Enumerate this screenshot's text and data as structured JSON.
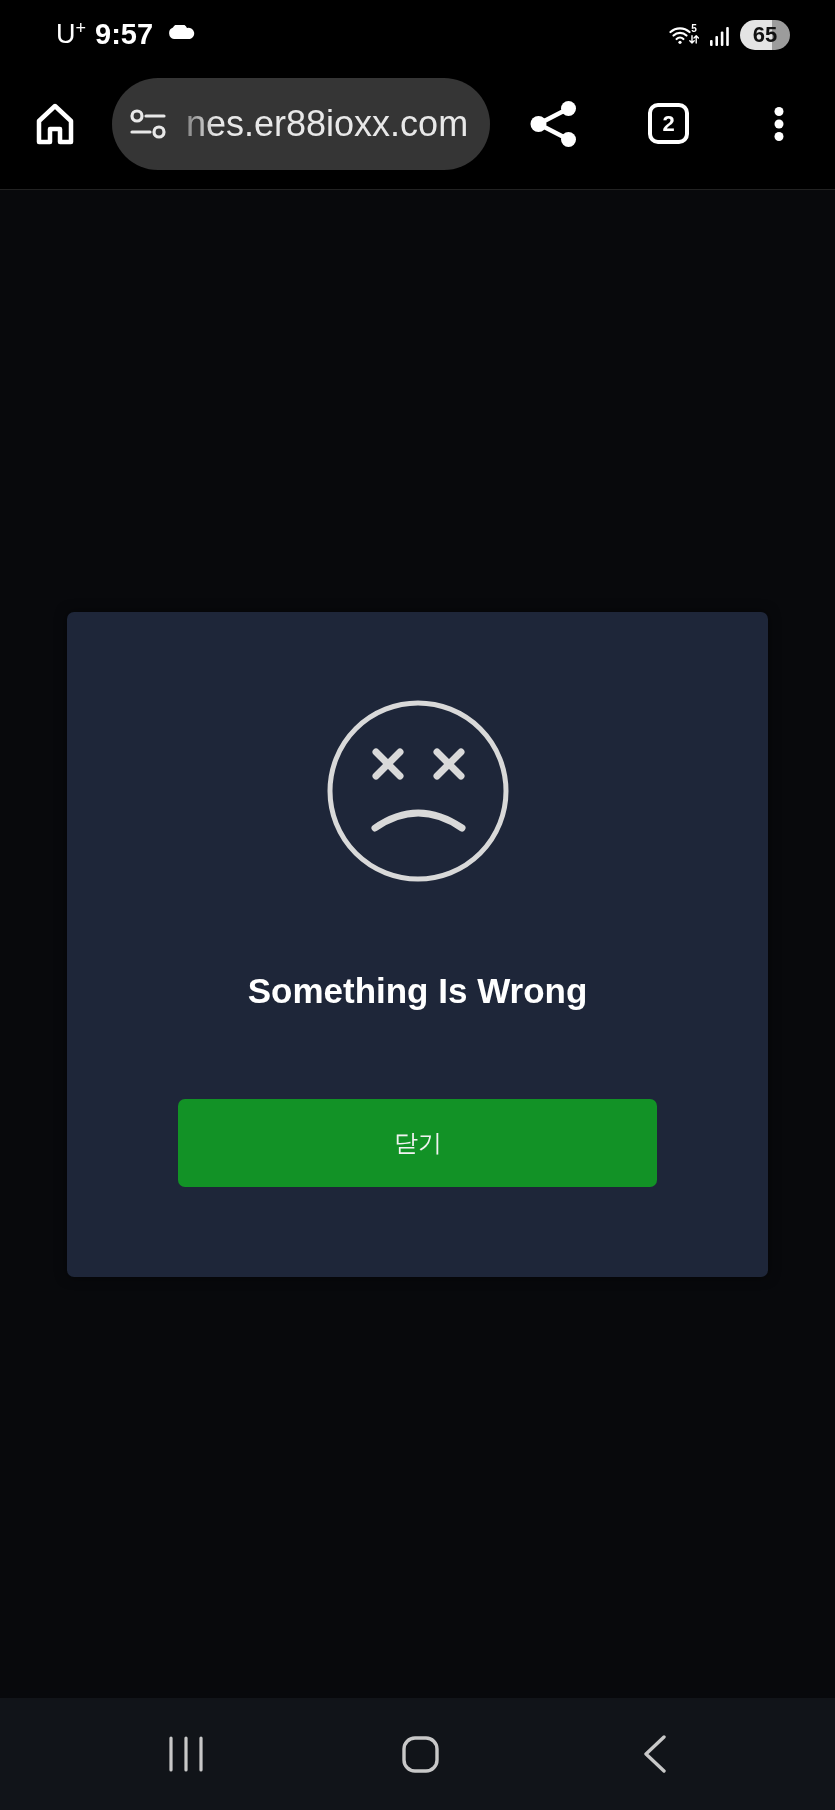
{
  "status_bar": {
    "carrier": "U$^{+}$",
    "time": "9:57",
    "wifi_badge": "5",
    "battery": "65"
  },
  "toolbar": {
    "url": "nes.er88ioxx.com",
    "tab_count": "2"
  },
  "dialog": {
    "title": "Something Is Wrong",
    "button": "닫기"
  }
}
